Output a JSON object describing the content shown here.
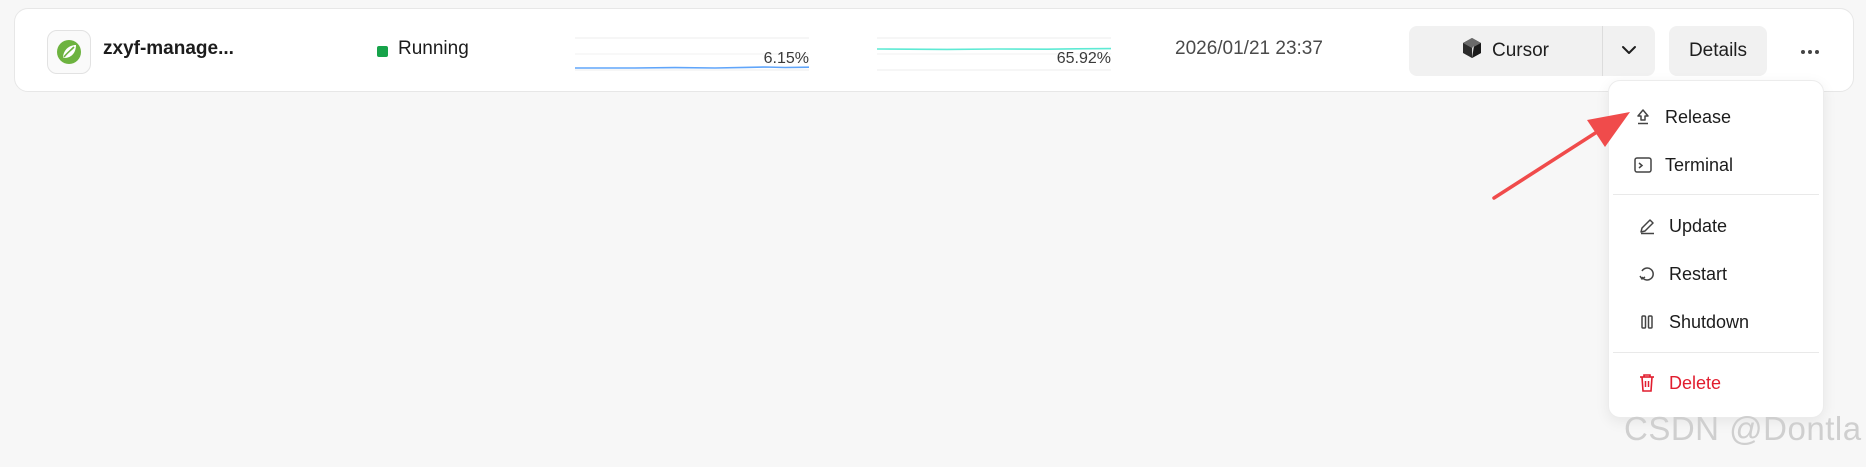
{
  "app": {
    "name": "zxyf-manage...",
    "status": "Running",
    "cpu": {
      "label": "6.15%",
      "percent": 6.15
    },
    "memory": {
      "label": "65.92%",
      "percent": 65.92
    },
    "timestamp": "2026/01/21 23:37",
    "open_with_label": "Cursor",
    "details_label": "Details"
  },
  "menu": {
    "items": [
      {
        "label": "Release",
        "icon": "release-icon"
      },
      {
        "label": "Terminal",
        "icon": "terminal-icon"
      },
      {
        "label": "Update",
        "icon": "pencil-icon"
      },
      {
        "label": "Restart",
        "icon": "restart-icon"
      },
      {
        "label": "Shutdown",
        "icon": "pause-icon"
      },
      {
        "label": "Delete",
        "icon": "trash-icon"
      }
    ]
  },
  "watermark": "CSDN @Dontla",
  "colors": {
    "status_running": "#16a34a",
    "cpu_line": "#60a5fa",
    "memory_line": "#5eead4",
    "danger": "#e11d2e",
    "arrow": "#f04b4b"
  }
}
